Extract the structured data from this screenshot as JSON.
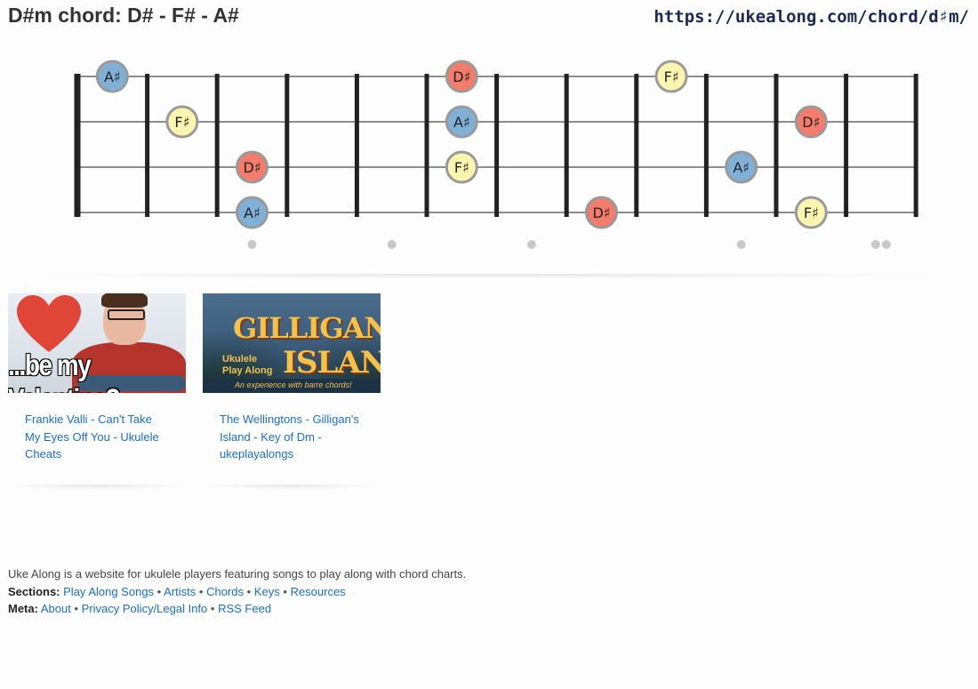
{
  "header": {
    "title": "D#m chord: D# - F# - A#",
    "url": "https://ukealong.com/chord/d♯m/"
  },
  "fretboard": {
    "strings": 4,
    "frets": 12,
    "fret_markers": [
      3,
      5,
      7,
      10,
      12
    ],
    "double_marker_fret": 12,
    "note_colors": {
      "D♯": "#f47c6c",
      "F♯": "#fbf5b0",
      "A♯": "#80b0d6"
    },
    "notes": [
      {
        "string": 1,
        "fret": 0,
        "label": "A♯"
      },
      {
        "string": 1,
        "fret": 5,
        "label": "D♯"
      },
      {
        "string": 1,
        "fret": 8,
        "label": "F♯"
      },
      {
        "string": 2,
        "fret": 1,
        "label": "F♯"
      },
      {
        "string": 2,
        "fret": 5,
        "label": "A♯"
      },
      {
        "string": 2,
        "fret": 10,
        "label": "D♯"
      },
      {
        "string": 3,
        "fret": 2,
        "label": "D♯"
      },
      {
        "string": 3,
        "fret": 5,
        "label": "F♯"
      },
      {
        "string": 3,
        "fret": 9,
        "label": "A♯"
      },
      {
        "string": 4,
        "fret": 2,
        "label": "A♯"
      },
      {
        "string": 4,
        "fret": 7,
        "label": "D♯"
      },
      {
        "string": 4,
        "fret": 10,
        "label": "F♯"
      }
    ]
  },
  "videos": [
    {
      "caption": "Frankie Valli - Can't Take My Eyes Off You - Ukulele Cheats",
      "thumb_text": "...be my Valentine?"
    },
    {
      "caption": "The Wellingtons - Gilligan's Island - Key of Dm - ukeplayalongs",
      "thumb_title_1": "GILLIGAN'S",
      "thumb_title_2": "ISLAND",
      "thumb_sub_1": "Ukulele",
      "thumb_sub_2": "Play Along",
      "thumb_tagline": "An experience with barre chords!"
    }
  ],
  "footer": {
    "description": "Uke Along is a website for ukulele players featuring songs to play along with chord charts.",
    "sections_label": "Sections:",
    "sections": [
      "Play Along Songs",
      "Artists",
      "Chords",
      "Keys",
      "Resources"
    ],
    "meta_label": "Meta:",
    "meta": [
      "About",
      "Privacy Policy/Legal Info",
      "RSS Feed"
    ],
    "separator": "•"
  }
}
